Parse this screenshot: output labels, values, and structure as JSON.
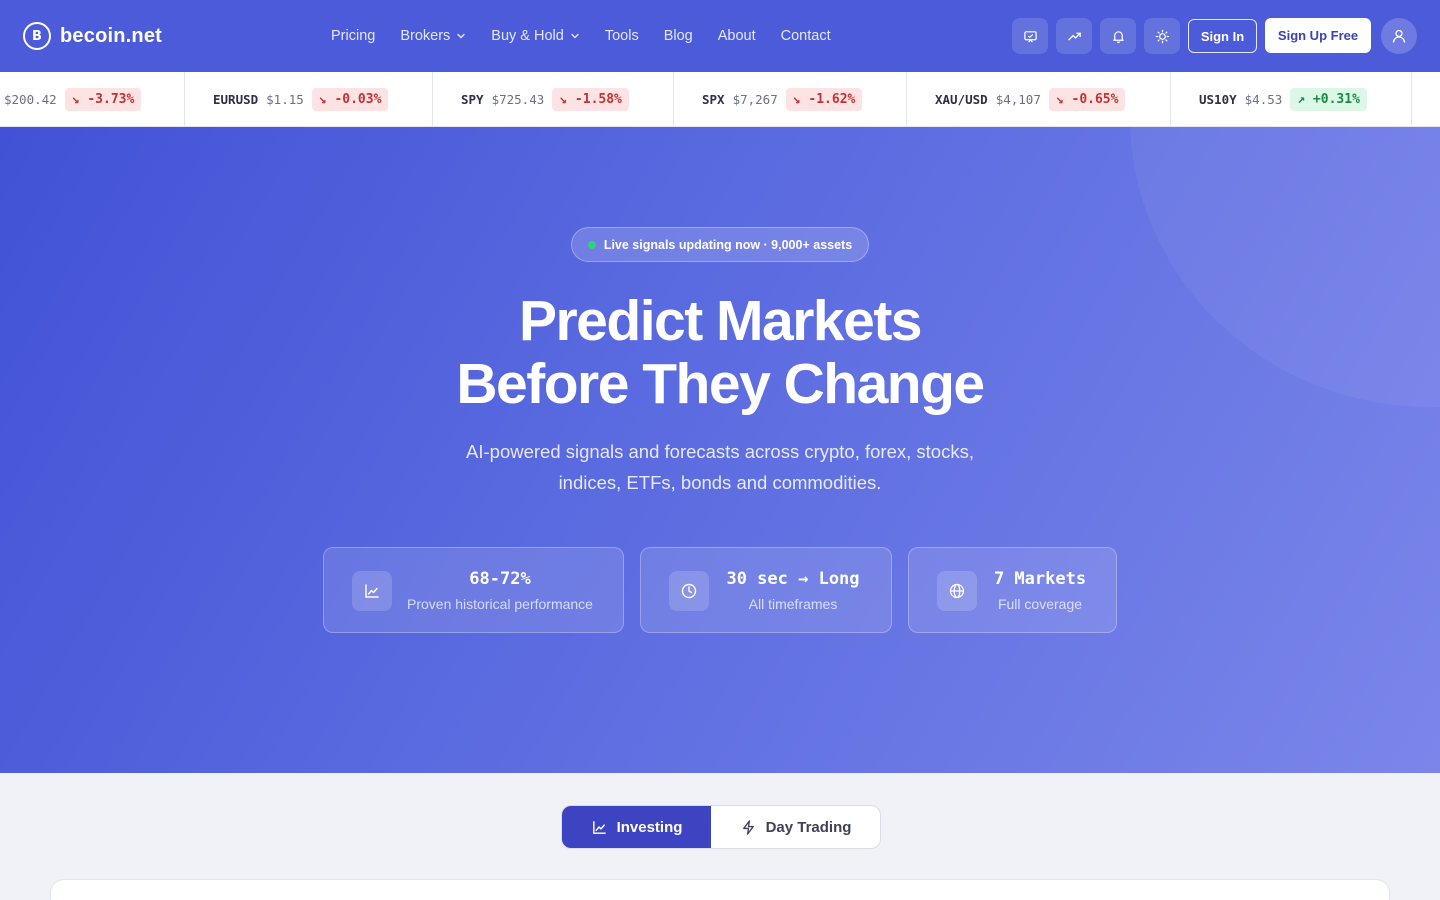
{
  "brand": {
    "mark": "B",
    "name": "becoin.net"
  },
  "nav": {
    "pricing": "Pricing",
    "brokers": "Brokers",
    "buy_hold": "Buy & Hold",
    "tools": "Tools",
    "blog": "Blog",
    "about": "About",
    "contact": "Contact"
  },
  "header_icons": [
    "chat-icon",
    "trend-icon",
    "bell-icon",
    "sun-icon",
    "user-icon"
  ],
  "auth": {
    "signin": "Sign In",
    "signup": "Sign Up Free"
  },
  "ticker": [
    {
      "symbol": "",
      "price": "$200.42",
      "change": "↘ -3.73%",
      "direction": "down"
    },
    {
      "symbol": "EURUSD",
      "price": "$1.15",
      "change": "↘ -0.03%",
      "direction": "down"
    },
    {
      "symbol": "SPY",
      "price": "$725.43",
      "change": "↘ -1.58%",
      "direction": "down"
    },
    {
      "symbol": "SPX",
      "price": "$7,267",
      "change": "↘ -1.62%",
      "direction": "down"
    },
    {
      "symbol": "XAU/USD",
      "price": "$4,107",
      "change": "↘ -0.65%",
      "direction": "down"
    },
    {
      "symbol": "US10Y",
      "price": "$4.53",
      "change": "↗ +0.31%",
      "direction": "up"
    }
  ],
  "hero": {
    "live_badge": "Live signals updating now · 9,000+ assets",
    "title_line1": "Predict Markets",
    "title_line2": "Before They Change",
    "subtitle": "AI-powered signals and forecasts across crypto, forex, stocks, indices, ETFs, bonds and commodities.",
    "stats": [
      {
        "icon": "chart-line-icon",
        "value": "68-72%",
        "label": "Proven historical performance"
      },
      {
        "icon": "clock-icon",
        "value": "30 sec → Long",
        "label": "All timeframes"
      },
      {
        "icon": "globe-icon",
        "value": "7 Markets",
        "label": "Full coverage"
      }
    ]
  },
  "tabs": {
    "investing": "Investing",
    "day_trading": "Day Trading",
    "active": "investing"
  },
  "colors": {
    "brand": "#4b5bd9",
    "tab_active": "#3d44c2",
    "down": "#c53232",
    "up": "#1c8a47",
    "live": "#31d17a"
  }
}
